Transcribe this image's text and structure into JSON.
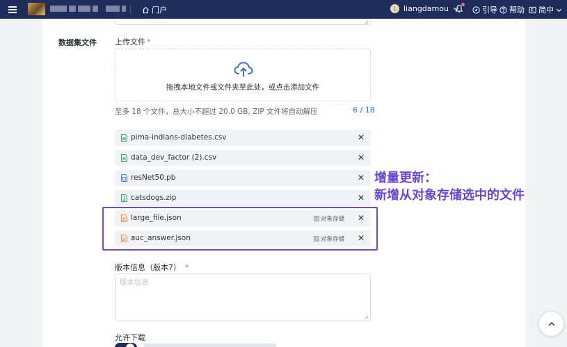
{
  "header": {
    "portal_label": "门户",
    "username": "liangdamou",
    "avatar_letter": "L",
    "guide_label": "引导",
    "help_label": "帮助",
    "language_label": "简中"
  },
  "form": {
    "section_title": "数据集文件",
    "upload_label": "上传文件",
    "required_mark": "*",
    "upload_instruction": "拖拽本地文件或文件夹至此处，或点击添加文件",
    "upload_hint": "至多 18 个文件，总大小不超过 20.0 GB, ZIP 文件将自动解压",
    "file_count": "6 / 18",
    "files": [
      {
        "name": "pima-indians-diabetes.csv",
        "tag": ""
      },
      {
        "name": "data_dev_factor (2).csv",
        "tag": ""
      },
      {
        "name": "resNet50.pb",
        "tag": ""
      },
      {
        "name": "catsdogs.zip",
        "tag": ""
      },
      {
        "name": "large_file.json",
        "tag": "对象存储"
      },
      {
        "name": "auc_answer.json",
        "tag": "对象存储"
      }
    ],
    "version_label": "版本信息（版本7）",
    "version_placeholder": "版本信息",
    "allow_download_label": "允许下载",
    "allow_download_on": true
  },
  "annotation": {
    "line1": "增量更新：",
    "line2": "新增从对象存储选中的文件",
    "color": "#6b45d6"
  },
  "colors": {
    "topbar": "#1f2d5c",
    "accent": "#3a6fd8",
    "highlight_border": "#7346d9",
    "required": "#f56c6c"
  }
}
